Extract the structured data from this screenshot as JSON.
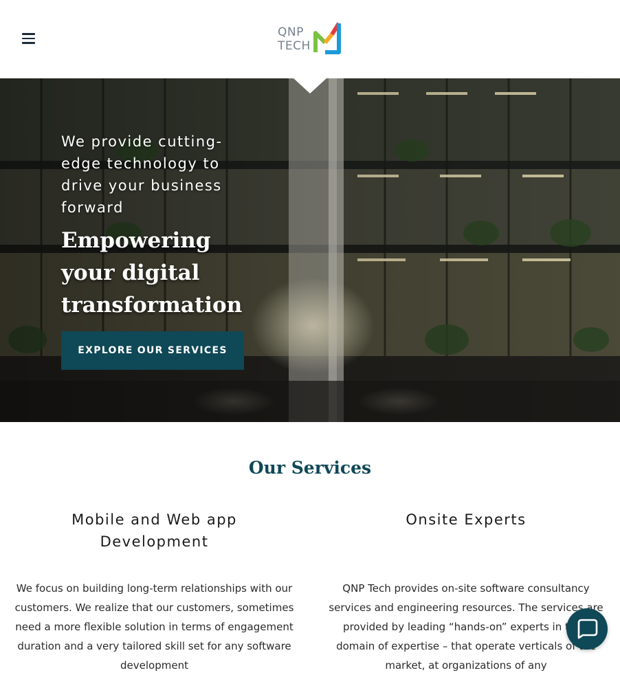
{
  "header": {
    "menu_icon": "hamburger-menu-icon",
    "logo": {
      "line1": "QNP",
      "line2": "TECH",
      "mark_colors": [
        "#7bc142",
        "#f7a823",
        "#e63c3c",
        "#1a9bd7"
      ]
    }
  },
  "hero": {
    "tagline": "We provide cutting-edge technology to drive your business forward",
    "headline": "Empowering your digital transformation",
    "cta_label": "EXPLORE OUR SERVICES"
  },
  "services": {
    "title": "Our Services",
    "items": [
      {
        "title": "Mobile and Web app Development",
        "body": "We focus on building long-term relationships with our customers. We realize that our customers, sometimes need a more flexible solution in terms of engagement duration and a very tailored skill set for any software development"
      },
      {
        "title": "Onsite Experts",
        "body": "QNP Tech  provides on-site software consultancy services and engineering resources. The services are provided by leading “hands-on” experts in their domain of expertise – that operate verticals of the market, at organizations of any"
      }
    ]
  },
  "chat": {
    "icon": "chat-bubble-icon"
  },
  "colors": {
    "accent": "#0f4856",
    "text": "#1b1b1b"
  }
}
